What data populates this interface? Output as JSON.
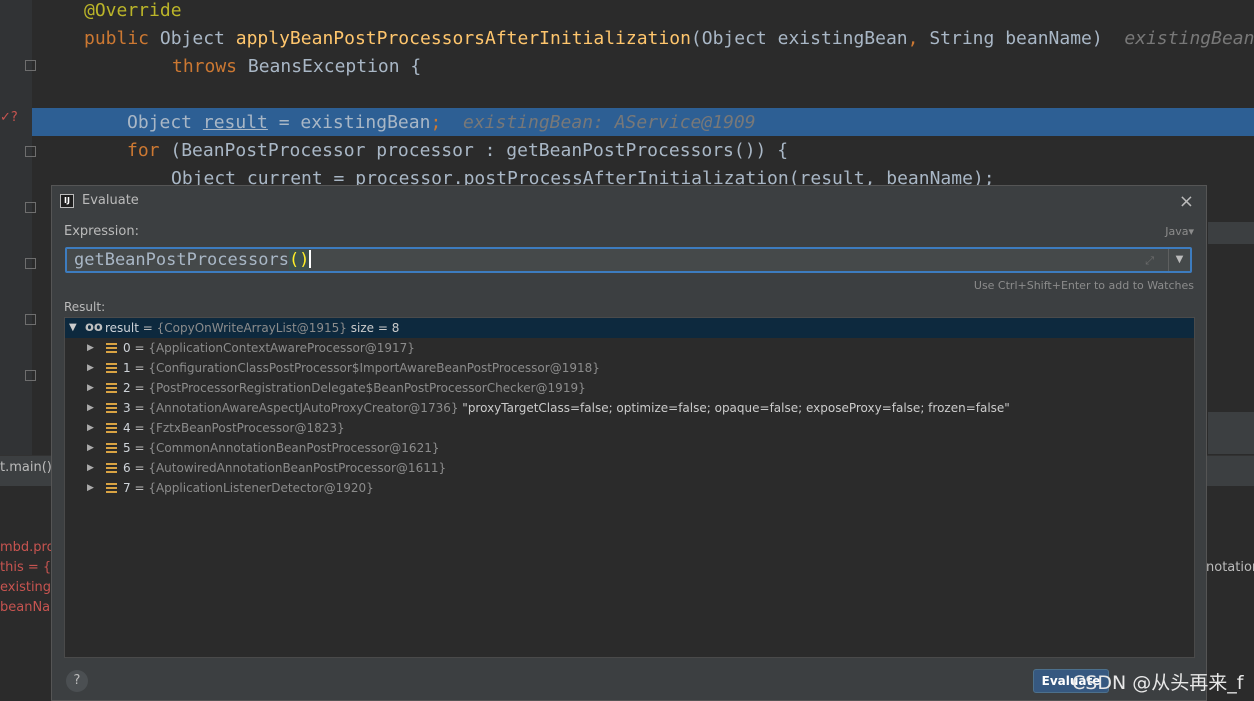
{
  "editor": {
    "lines": {
      "annotation": "@Override",
      "signature_kw": "public",
      "signature_type": "Object",
      "signature_fn": "applyBeanPostProcessorsAfterInitialization",
      "signature_params_a": "(Object existingBean",
      "signature_comma": ",",
      "signature_params_b": " String beanName)",
      "signature_hint": "existingBean",
      "throws_kw": "throws",
      "throws_rest": " BeansException {",
      "result_a": "Object ",
      "result_var": "result",
      "result_b": " = existingBean",
      "result_semi": ";",
      "result_hint": "existingBean: AService@1909",
      "for_kw": "for",
      "for_rest": " (BeanPostProcessor processor : getBeanPostProcessors()) {",
      "current_line": "Object current = processor.postProcessAfterInitialization(result, beanName);"
    }
  },
  "background": {
    "frame_label": "t.main()",
    "variables": [
      "mbd.pro",
      "this = {D",
      "existingB",
      "beanNar"
    ],
    "right_text": "notation"
  },
  "dialog": {
    "title": "Evaluate",
    "app_icon": "IJ",
    "close_label": "×",
    "expression_label": "Expression:",
    "language": "Java▾",
    "expression_value": "getBeanPostProcessors",
    "expression_parens": "()",
    "watch_hint": "Use Ctrl+Shift+Enter to add to Watches",
    "result_label": "Result:",
    "result_root": {
      "name": "result",
      "eq": " = ",
      "ref": "{CopyOnWriteArrayList@1915}",
      "extra": "  size = 8"
    },
    "result_items": [
      {
        "index": "0",
        "ref": "{ApplicationContextAwareProcessor@1917}",
        "extra": ""
      },
      {
        "index": "1",
        "ref": "{ConfigurationClassPostProcessor$ImportAwareBeanPostProcessor@1918}",
        "extra": ""
      },
      {
        "index": "2",
        "ref": "{PostProcessorRegistrationDelegate$BeanPostProcessorChecker@1919}",
        "extra": ""
      },
      {
        "index": "3",
        "ref": "{AnnotationAwareAspectJAutoProxyCreator@1736}",
        "extra": " \"proxyTargetClass=false; optimize=false; opaque=false; exposeProxy=false; frozen=false\""
      },
      {
        "index": "4",
        "ref": "{FztxBeanPostProcessor@1823}",
        "extra": ""
      },
      {
        "index": "5",
        "ref": "{CommonAnnotationBeanPostProcessor@1621}",
        "extra": ""
      },
      {
        "index": "6",
        "ref": "{AutowiredAnnotationBeanPostProcessor@1611}",
        "extra": ""
      },
      {
        "index": "7",
        "ref": "{ApplicationListenerDetector@1920}",
        "extra": ""
      }
    ],
    "eq_sign": " = ",
    "help_label": "?",
    "evaluate_label": "Evaluate"
  },
  "watermark": "CSDN @从头再来_f",
  "icons": [
    "app-icon",
    "close-icon",
    "expand-icon",
    "history-dropdown-icon",
    "expand-triangle-icon",
    "watch-glasses-icon",
    "list-icon",
    "help-icon"
  ],
  "colors": {
    "keyword": "#cc7832",
    "annotation": "#bbb529",
    "function": "#ffc66d",
    "selection": "#2d5f94",
    "button": "#365880"
  }
}
